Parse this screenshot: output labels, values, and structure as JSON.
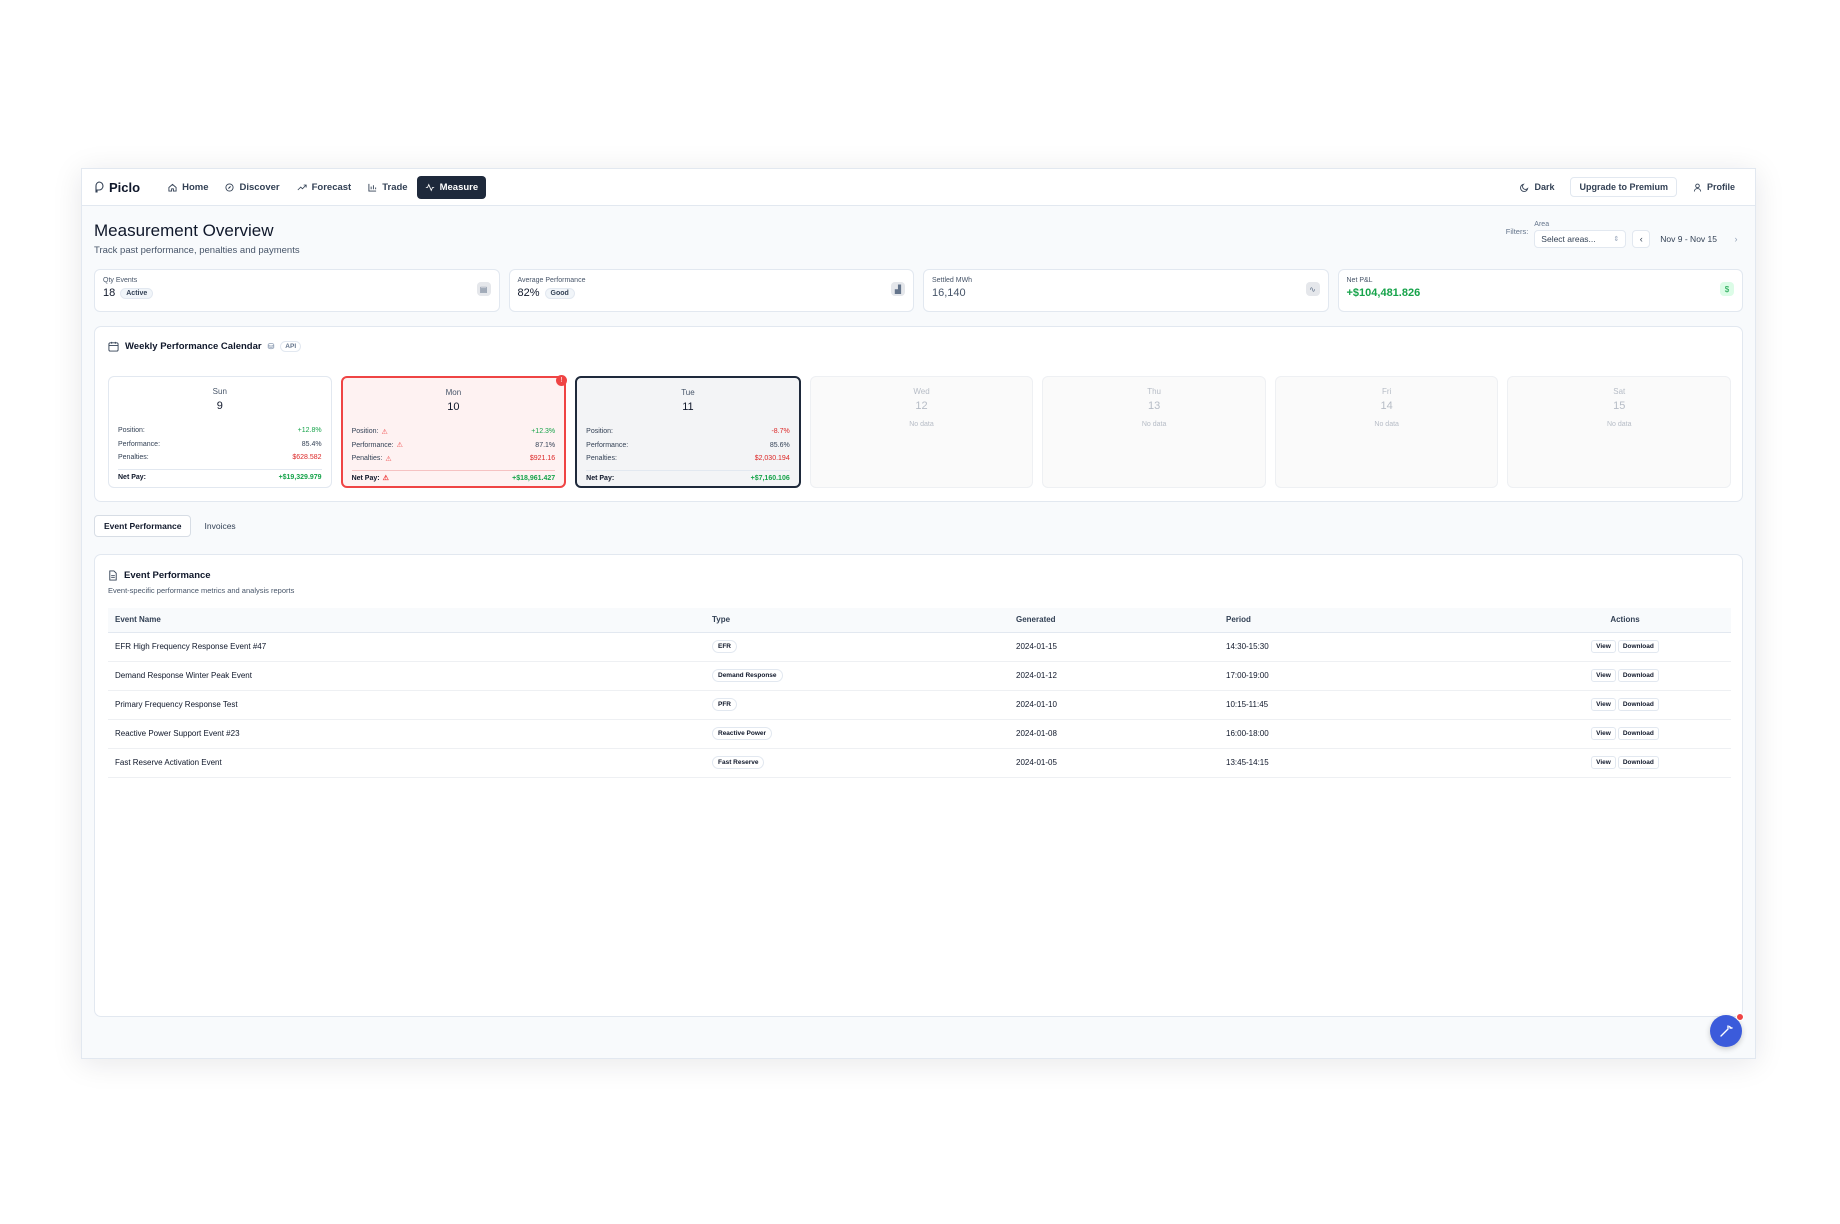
{
  "nav": {
    "brand": "Piclo",
    "items": [
      {
        "label": "Home",
        "icon": "home-icon"
      },
      {
        "label": "Discover",
        "icon": "compass-icon"
      },
      {
        "label": "Forecast",
        "icon": "trending-up-icon"
      },
      {
        "label": "Trade",
        "icon": "bar-chart-icon"
      },
      {
        "label": "Measure",
        "icon": "activity-icon",
        "active": true
      }
    ],
    "theme_label": "Dark",
    "upgrade_label": "Upgrade to Premium",
    "profile_label": "Profile"
  },
  "header": {
    "title": "Measurement Overview",
    "subtitle": "Track past performance, penalties and payments",
    "filters_label": "Filters:",
    "area_label": "Area",
    "area_placeholder": "Select areas...",
    "date_range": "Nov 9 - Nov 15"
  },
  "stats": [
    {
      "label": "Qty Events",
      "value": "18",
      "badge": "Active",
      "icon": "calendar-stack-icon"
    },
    {
      "label": "Average Performance",
      "value": "82%",
      "badge": "Good",
      "icon": "bar-chart-icon"
    },
    {
      "label": "Settled MWh",
      "value": "16,140",
      "icon": "activity-icon"
    },
    {
      "label": "Net P&L",
      "value": "+$104,481.826",
      "icon": "dollar-icon"
    }
  ],
  "calendar": {
    "title": "Weekly Performance Calendar",
    "api_label": "API",
    "labels": {
      "position": "Position:",
      "performance": "Performance:",
      "penalties": "Penalties:",
      "net_pay": "Net Pay:"
    },
    "no_data": "No data",
    "days": [
      {
        "name": "Sun",
        "num": "9",
        "position": "+12.8%",
        "performance": "85.4%",
        "penalties": "$628.582",
        "net_pay": "+$19,329.979"
      },
      {
        "name": "Mon",
        "num": "10",
        "position": "+12.3%",
        "performance": "87.1%",
        "penalties": "$921.16",
        "net_pay": "+$18,961.427"
      },
      {
        "name": "Tue",
        "num": "11",
        "position": "-8.7%",
        "performance": "85.6%",
        "penalties": "$2,030.194",
        "net_pay": "+$7,160.106"
      },
      {
        "name": "Wed",
        "num": "12"
      },
      {
        "name": "Thu",
        "num": "13"
      },
      {
        "name": "Fri",
        "num": "14"
      },
      {
        "name": "Sat",
        "num": "15"
      }
    ]
  },
  "tabs": [
    "Event Performance",
    "Invoices"
  ],
  "events": {
    "title": "Event Performance",
    "subtitle": "Event-specific performance metrics and analysis reports",
    "columns": [
      "Event Name",
      "Type",
      "Generated",
      "Period",
      "Actions"
    ],
    "view_label": "View",
    "download_label": "Download",
    "rows": [
      {
        "name": "EFR High Frequency Response Event #47",
        "type": "EFR",
        "generated": "2024-01-15",
        "period": "14:30-15:30"
      },
      {
        "name": "Demand Response Winter Peak Event",
        "type": "Demand Response",
        "generated": "2024-01-12",
        "period": "17:00-19:00"
      },
      {
        "name": "Primary Frequency Response Test",
        "type": "PFR",
        "generated": "2024-01-10",
        "period": "10:15-11:45"
      },
      {
        "name": "Reactive Power Support Event #23",
        "type": "Reactive Power",
        "generated": "2024-01-08",
        "period": "16:00-18:00"
      },
      {
        "name": "Fast Reserve Activation Event",
        "type": "Fast Reserve",
        "generated": "2024-01-05",
        "period": "13:45-14:15"
      }
    ]
  },
  "colors": {
    "accent": "#1e293b",
    "positive": "#16a34a",
    "negative": "#dc2626",
    "alert": "#ef4444",
    "fab": "#3b5bdb"
  }
}
